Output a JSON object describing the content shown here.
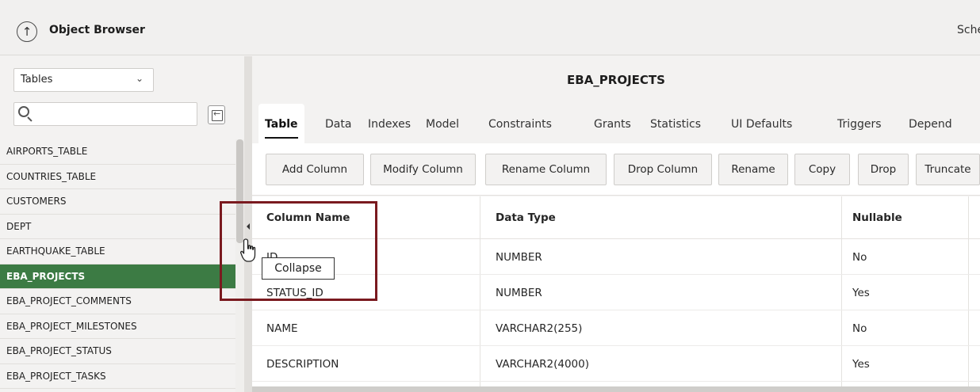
{
  "header": {
    "title": "Object Browser",
    "right_text": "Sche"
  },
  "left_panel": {
    "object_type": "Tables",
    "search_placeholder": "",
    "items": [
      {
        "label": "AIRPORTS_TABLE"
      },
      {
        "label": "COUNTRIES_TABLE"
      },
      {
        "label": "CUSTOMERS"
      },
      {
        "label": "DEPT"
      },
      {
        "label": "EARTHQUAKE_TABLE"
      },
      {
        "label": "EBA_PROJECTS",
        "selected": true
      },
      {
        "label": "EBA_PROJECT_COMMENTS"
      },
      {
        "label": "EBA_PROJECT_MILESTONES"
      },
      {
        "label": "EBA_PROJECT_STATUS"
      },
      {
        "label": "EBA_PROJECT_TASKS"
      }
    ]
  },
  "main": {
    "object_name": "EBA_PROJECTS",
    "tabs": [
      "Table",
      "Data",
      "Indexes",
      "Model",
      "Constraints",
      "Grants",
      "Statistics",
      "UI Defaults",
      "Triggers",
      "Depend"
    ],
    "active_tab": "Table",
    "toolbar": [
      "Add Column",
      "Modify Column",
      "Rename Column",
      "Drop Column",
      "Rename",
      "Copy",
      "Drop",
      "Truncate"
    ],
    "columns": {
      "headers": [
        "Column Name",
        "Data Type",
        "Nullable"
      ],
      "rows": [
        {
          "name": "ID",
          "type": "NUMBER",
          "nullable": "No"
        },
        {
          "name": "STATUS_ID",
          "type": "NUMBER",
          "nullable": "Yes"
        },
        {
          "name": "NAME",
          "type": "VARCHAR2(255)",
          "nullable": "No"
        },
        {
          "name": "DESCRIPTION",
          "type": "VARCHAR2(4000)",
          "nullable": "Yes"
        }
      ]
    }
  },
  "tooltip": "Collapse",
  "colors": {
    "selected_row": "#3c7b44",
    "highlight_border": "#7a1a1f"
  }
}
